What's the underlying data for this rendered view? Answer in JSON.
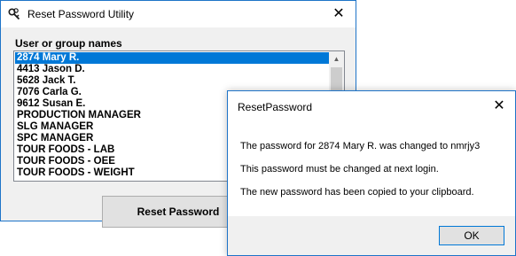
{
  "main_window": {
    "title": "Reset Password Utility",
    "close_glyph": "✕",
    "list_label": "User or group names",
    "items": [
      "2874 Mary R.",
      "4413 Jason D.",
      "5628 Jack T.",
      "7076 Carla G.",
      "9612 Susan E.",
      "PRODUCTION MANAGER",
      "SLG MANAGER",
      "SPC MANAGER",
      "TOUR FOODS - LAB",
      "TOUR FOODS - OEE",
      "TOUR FOODS - WEIGHT"
    ],
    "selected_item": "2874 Mary R.",
    "reset_button": "Reset Password",
    "scroll_up_glyph": "▲",
    "scroll_down_glyph": "▼"
  },
  "dialog": {
    "title": "ResetPassword",
    "close_glyph": "✕",
    "messages": [
      "The password for 2874 Mary R. was changed to nmrjy3",
      "This password must be changed at next login.",
      "The new password has been copied to your clipboard."
    ],
    "ok_button": "OK"
  },
  "colors": {
    "accent": "#0078d7",
    "window_border": "#1e74c8",
    "dialog_background": "#ffffff",
    "window_background": "#f0f0f0"
  },
  "icons": {
    "app": "key-icon",
    "close": "close-icon"
  }
}
